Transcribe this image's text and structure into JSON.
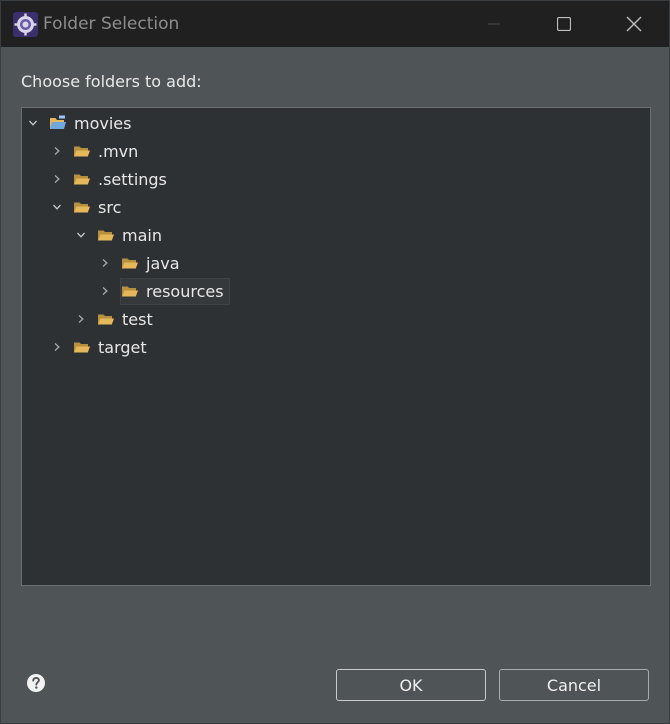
{
  "window": {
    "title": "Folder Selection"
  },
  "dialog": {
    "prompt": "Choose folders to add:"
  },
  "tree": {
    "nodes": [
      {
        "label": "movies",
        "depth": 0,
        "expanded": true,
        "icon": "project-folder-icon"
      },
      {
        "label": ".mvn",
        "depth": 1,
        "expanded": false,
        "icon": "folder-icon"
      },
      {
        "label": ".settings",
        "depth": 1,
        "expanded": false,
        "icon": "folder-icon"
      },
      {
        "label": "src",
        "depth": 1,
        "expanded": true,
        "icon": "folder-icon"
      },
      {
        "label": "main",
        "depth": 2,
        "expanded": true,
        "icon": "folder-icon"
      },
      {
        "label": "java",
        "depth": 3,
        "expanded": false,
        "icon": "folder-icon"
      },
      {
        "label": "resources",
        "depth": 3,
        "expanded": false,
        "icon": "folder-icon",
        "selected": true
      },
      {
        "label": "test",
        "depth": 2,
        "expanded": false,
        "icon": "folder-icon"
      },
      {
        "label": "target",
        "depth": 1,
        "expanded": false,
        "icon": "folder-icon"
      }
    ]
  },
  "buttons": {
    "ok": "OK",
    "cancel": "Cancel"
  },
  "colors": {
    "titlebar": "#202020",
    "dialog_bg": "#4f5456",
    "tree_bg": "#2e3133",
    "folder": "#e6b85c",
    "text": "#e8e8e8"
  }
}
